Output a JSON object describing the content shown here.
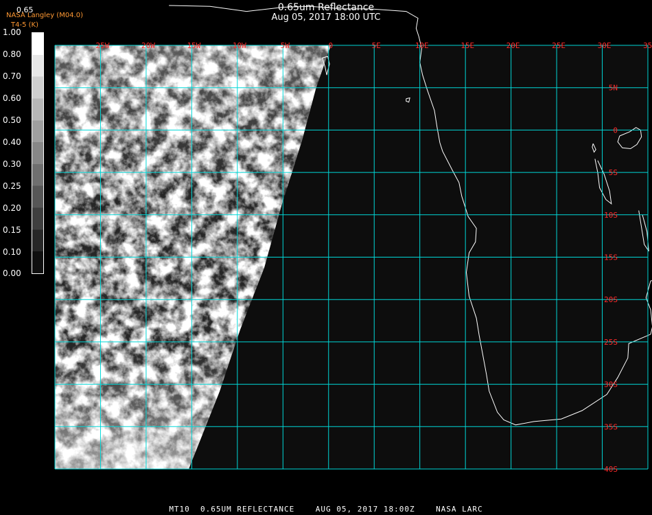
{
  "header": {
    "title": "0.65um Reflectance",
    "subtitle": "Aug 05, 2017 18:00 UTC"
  },
  "credit": {
    "line1": "NASA Langley (M04.0)",
    "line2": "T4-5 (K)"
  },
  "colorbar": {
    "top_label": "0.65",
    "tick_labels": [
      "1.00",
      "0.80",
      "0.70",
      "0.60",
      "0.50",
      "0.40",
      "0.30",
      "0.25",
      "0.20",
      "0.15",
      "0.10",
      "0.00"
    ],
    "value_range": [
      0.0,
      1.0
    ]
  },
  "map": {
    "longitude_labels": [
      "25W",
      "20W",
      "15W",
      "10W",
      "5W",
      "0",
      "5E",
      "10E",
      "15E",
      "20E",
      "25E",
      "30E",
      "35E"
    ],
    "latitude_labels": [
      "5N",
      "0",
      "5S",
      "10S",
      "15S",
      "20S",
      "25S",
      "30S",
      "35S",
      "40S"
    ],
    "lon_range": [
      -30,
      35
    ],
    "lat_range": [
      -40,
      10
    ],
    "grid_color": "#00d8d8",
    "label_color": "#ff2a2a",
    "coast_color": "#ffffff",
    "coastline_africa": [
      [
        -17.5,
        14.7
      ],
      [
        -13,
        14.6
      ],
      [
        -9,
        14
      ],
      [
        -5,
        14.5
      ],
      [
        -2,
        14.6
      ],
      [
        1.5,
        14.3
      ],
      [
        4.5,
        14.3
      ],
      [
        8.5,
        14
      ],
      [
        9.8,
        13.2
      ],
      [
        9.6,
        12
      ],
      [
        9.9,
        11
      ],
      [
        10.2,
        9.6
      ],
      [
        10,
        8
      ],
      [
        10.3,
        6.5
      ],
      [
        10.8,
        4.8
      ],
      [
        11.6,
        2.3
      ],
      [
        11.9,
        0.3
      ],
      [
        12.2,
        -1.5
      ],
      [
        12.5,
        -2.5
      ],
      [
        13.6,
        -4.8
      ],
      [
        14.3,
        -6.2
      ],
      [
        14.6,
        -7.8
      ],
      [
        15.3,
        -10.2
      ],
      [
        16.2,
        -11.6
      ],
      [
        16.1,
        -13.2
      ],
      [
        15.4,
        -14.5
      ],
      [
        15.1,
        -16.8
      ],
      [
        15.4,
        -19.6
      ],
      [
        16.2,
        -22.2
      ],
      [
        16.5,
        -24.2
      ],
      [
        16.9,
        -26.5
      ],
      [
        17.3,
        -28.8
      ],
      [
        17.6,
        -30.8
      ],
      [
        18.5,
        -33.3
      ],
      [
        19.2,
        -34.2
      ],
      [
        20.5,
        -34.8
      ],
      [
        22.5,
        -34.4
      ],
      [
        25.5,
        -34.1
      ],
      [
        27.8,
        -33.1
      ],
      [
        30.5,
        -31.2
      ],
      [
        31.7,
        -29.2
      ],
      [
        32.8,
        -26.9
      ],
      [
        32.9,
        -25.2
      ],
      [
        35.3,
        -24.1
      ],
      [
        35.5,
        -23.2
      ],
      [
        35.3,
        -21.2
      ],
      [
        34.8,
        -19.8
      ],
      [
        35.3,
        -17.8
      ],
      [
        37.5,
        -17.2
      ],
      [
        40.5,
        -14.5
      ],
      [
        40.4,
        -11.4
      ],
      [
        40.0,
        -10.6
      ],
      [
        39.5,
        -9.5
      ],
      [
        39.4,
        -7.5
      ],
      [
        38.8,
        -5.9
      ],
      [
        39.5,
        -4.5
      ],
      [
        40.3,
        -3.0
      ]
    ],
    "lake_victoria": [
      [
        31.9,
        -0.7
      ],
      [
        33.0,
        -0.2
      ],
      [
        33.7,
        0.3
      ],
      [
        34.2,
        0.0
      ],
      [
        34.3,
        -0.8
      ],
      [
        33.8,
        -1.7
      ],
      [
        33.1,
        -2.2
      ],
      [
        32.2,
        -2.1
      ],
      [
        31.7,
        -1.4
      ],
      [
        31.9,
        -0.7
      ]
    ],
    "lake_tanganyika": [
      [
        29.2,
        -3.4
      ],
      [
        29.5,
        -5.0
      ],
      [
        29.7,
        -6.8
      ],
      [
        30.4,
        -8.2
      ],
      [
        31.0,
        -8.7
      ],
      [
        30.8,
        -7.2
      ],
      [
        30.2,
        -5.2
      ],
      [
        29.5,
        -3.6
      ]
    ],
    "lake_malawi": [
      [
        34.0,
        -9.5
      ],
      [
        34.3,
        -11.5
      ],
      [
        34.6,
        -13.5
      ],
      [
        35.1,
        -14.3
      ],
      [
        34.9,
        -12.0
      ],
      [
        34.4,
        -10.0
      ]
    ],
    "lake_volta": [
      [
        -0.2,
        6.5
      ],
      [
        -0.4,
        7.5
      ],
      [
        -0.7,
        8.5
      ],
      [
        -0.1,
        8.7
      ],
      [
        0.1,
        7.8
      ],
      [
        -0.2,
        6.5
      ]
    ],
    "bioko": [
      [
        8.5,
        3.7
      ],
      [
        8.9,
        3.8
      ],
      [
        8.8,
        3.3
      ],
      [
        8.5,
        3.4
      ],
      [
        8.5,
        3.7
      ]
    ],
    "lake_kivu_like": [
      [
        29.0,
        -1.6
      ],
      [
        29.3,
        -2.3
      ],
      [
        29.1,
        -2.6
      ],
      [
        28.9,
        -2.0
      ],
      [
        29.0,
        -1.6
      ]
    ]
  },
  "footer": {
    "text": "MT10  0.65UM REFLECTANCE    AUG 05, 2017 18:00Z    NASA LARC"
  }
}
